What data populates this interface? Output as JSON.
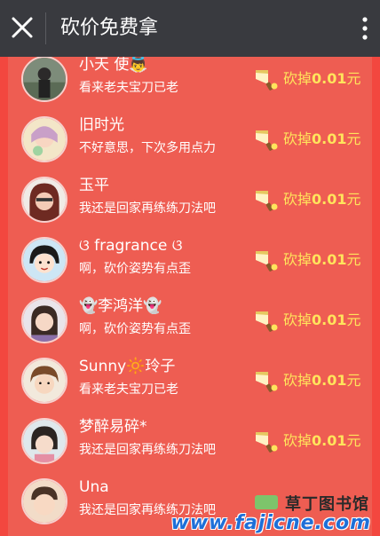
{
  "topbar": {
    "title": "砍价免费拿"
  },
  "rows": [
    {
      "name": "小天 使👼",
      "message": "看来老夫宝刀已老",
      "cut_prefix": "砍掉",
      "cut_amount": "0.01",
      "cut_unit": "元"
    },
    {
      "name": "旧时光",
      "message": "不好意思，下次多用点力",
      "cut_prefix": "砍掉",
      "cut_amount": "0.01",
      "cut_unit": "元"
    },
    {
      "name": "玉平",
      "message": "我还是回家再练练刀法吧",
      "cut_prefix": "砍掉",
      "cut_amount": "0.01",
      "cut_unit": "元"
    },
    {
      "name": "ଓ fragrance ଓ",
      "message": "啊，砍价姿势有点歪",
      "cut_prefix": "砍掉",
      "cut_amount": "0.01",
      "cut_unit": "元"
    },
    {
      "name": "👻李鸿洋👻",
      "message": "啊，砍价姿势有点歪",
      "cut_prefix": "砍掉",
      "cut_amount": "0.01",
      "cut_unit": "元"
    },
    {
      "name": "Sunny🔆玲子",
      "message": "看来老夫宝刀已老",
      "cut_prefix": "砍掉",
      "cut_amount": "0.01",
      "cut_unit": "元"
    },
    {
      "name": "梦醉易碎*",
      "message": "我还是回家再练练刀法吧",
      "cut_prefix": "砍掉",
      "cut_amount": "0.01",
      "cut_unit": "元"
    },
    {
      "name": "Una",
      "message": "我还是回家再练练刀法吧",
      "cut_prefix": "",
      "cut_amount": "",
      "cut_unit": ""
    }
  ],
  "watermark": {
    "cn": "草丁图书馆",
    "url": "www.fajicne.com"
  },
  "colors": {
    "topbar": "#393A3F",
    "panel": "#EE5D52",
    "cut_text": "#FFE45C"
  }
}
